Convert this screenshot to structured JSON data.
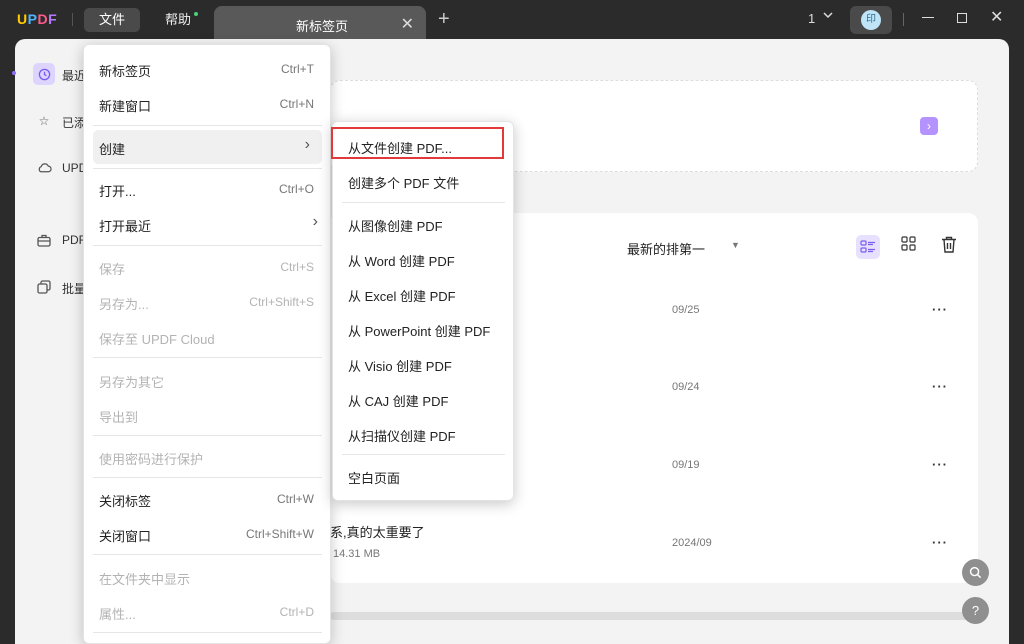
{
  "app": {
    "logo": "UPDF"
  },
  "titlebar": {
    "menu_file": "文件",
    "menu_help": "帮助",
    "tab_label": "新标签页",
    "tab_close": "✕",
    "tab_add": "+",
    "window_count": "1",
    "avatar_text": "印"
  },
  "sidebar": {
    "items": [
      {
        "label": "最近",
        "icon": "clock-icon"
      },
      {
        "label": "已添",
        "icon": "star-icon"
      },
      {
        "label": "UPD",
        "icon": "cloud-icon"
      },
      {
        "label": "PDF",
        "icon": "briefcase-icon"
      },
      {
        "label": "批量",
        "icon": "copy-icon"
      }
    ]
  },
  "main": {
    "sort_label": "最新的排第一",
    "rows": [
      {
        "date": "09/25"
      },
      {
        "date": "09/24"
      },
      {
        "date": "09/19"
      },
      {
        "date": "2024/09",
        "title": "系,真的太重要了",
        "size": "14.31 MB"
      }
    ]
  },
  "file_menu": {
    "items": [
      {
        "label": "新标签页",
        "shortcut": "Ctrl+T"
      },
      {
        "label": "新建窗口",
        "shortcut": "Ctrl+N"
      },
      {
        "label": "创建"
      },
      {
        "label": "打开...",
        "shortcut": "Ctrl+O"
      },
      {
        "label": "打开最近"
      },
      {
        "label": "保存",
        "shortcut": "Ctrl+S"
      },
      {
        "label": "另存为...",
        "shortcut": "Ctrl+Shift+S"
      },
      {
        "label": "保存至 UPDF Cloud"
      },
      {
        "label": "另存为其它"
      },
      {
        "label": "导出到"
      },
      {
        "label": "使用密码进行保护"
      },
      {
        "label": "关闭标签",
        "shortcut": "Ctrl+W"
      },
      {
        "label": "关闭窗口",
        "shortcut": "Ctrl+Shift+W"
      },
      {
        "label": "在文件夹中显示"
      },
      {
        "label": "属性...",
        "shortcut": "Ctrl+D"
      }
    ]
  },
  "create_menu": {
    "items": [
      {
        "label": "从文件创建 PDF..."
      },
      {
        "label": "创建多个 PDF 文件"
      },
      {
        "label": "从图像创建 PDF"
      },
      {
        "label": "从 Word 创建 PDF"
      },
      {
        "label": "从 Excel 创建 PDF"
      },
      {
        "label": "从 PowerPoint 创建 PDF"
      },
      {
        "label": "从 Visio 创建 PDF"
      },
      {
        "label": "从 CAJ 创建 PDF"
      },
      {
        "label": "从扫描仪创建 PDF"
      },
      {
        "label": "空白页面"
      }
    ]
  },
  "colors": {
    "accent": "#7a5bf0",
    "highlight_border": "#e03a3a"
  }
}
